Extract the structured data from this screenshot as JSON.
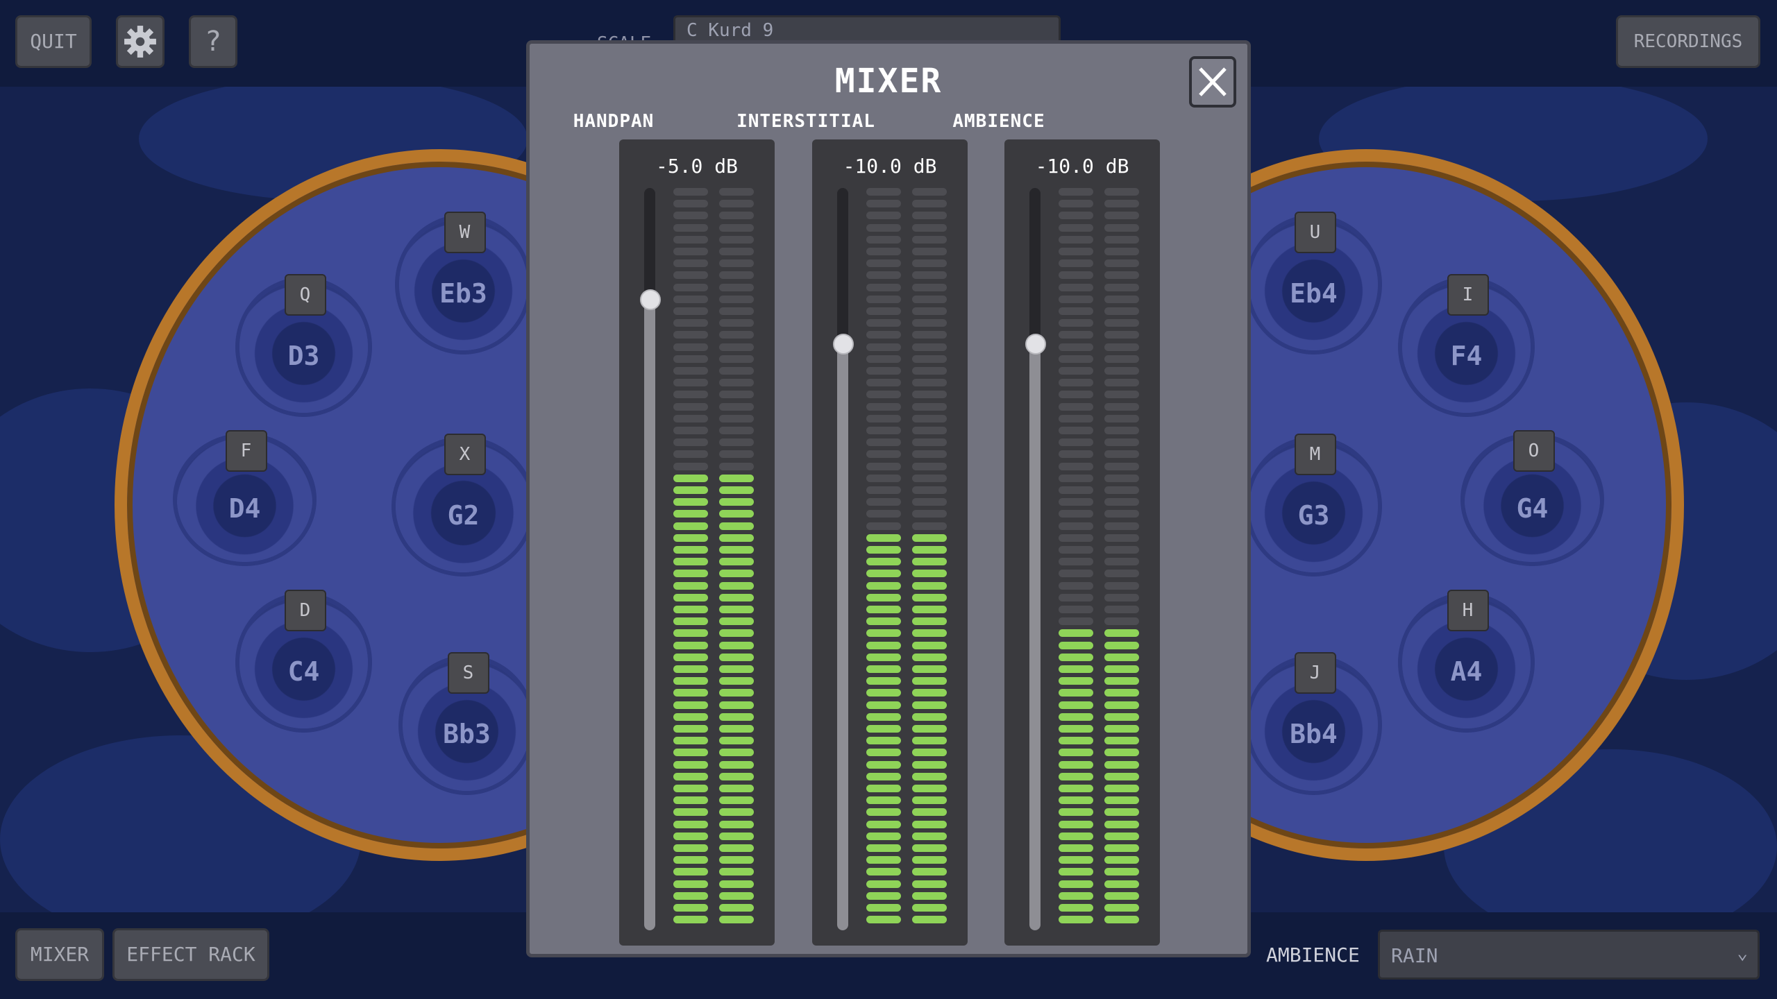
{
  "toolbar": {
    "quit_label": "QUIT",
    "help_label": "?",
    "scale_label": "SCALE",
    "scale_value": "C Kurd 9",
    "recordings_label": "RECORDINGS"
  },
  "bottom": {
    "mixer_label": "MIXER",
    "effect_rack_label": "EFFECT RACK",
    "ambience_label": "AMBIENCE",
    "ambience_value": "RAIN"
  },
  "handpan_left": [
    {
      "key": "W",
      "note": "Eb3"
    },
    {
      "key": "Q",
      "note": "D3"
    },
    {
      "key": "F",
      "note": "D4"
    },
    {
      "key": "X",
      "note": "G2"
    },
    {
      "key": "D",
      "note": "C4"
    },
    {
      "key": "S",
      "note": "Bb3"
    }
  ],
  "handpan_right": [
    {
      "key": "U",
      "note": "Eb4"
    },
    {
      "key": "I",
      "note": "F4"
    },
    {
      "key": "M",
      "note": "G3"
    },
    {
      "key": "O",
      "note": "G4"
    },
    {
      "key": "H",
      "note": "A4"
    },
    {
      "key": "J",
      "note": "Bb4"
    }
  ],
  "mixer": {
    "title": "MIXER",
    "channels": [
      {
        "name": "HANDPAN",
        "db_label": "-5.0 dB",
        "fader_level": 0.85,
        "meter_level": 0.62
      },
      {
        "name": "INTERSTITIAL",
        "db_label": "-10.0 dB",
        "fader_level": 0.79,
        "meter_level": 0.54
      },
      {
        "name": "AMBIENCE",
        "db_label": "-10.0 dB",
        "fader_level": 0.79,
        "meter_level": 0.4
      }
    ]
  },
  "colors": {
    "meter_on": "#8fd458",
    "meter_off": "#4d4d52",
    "dialog": "#72737f",
    "pan_rim": "#b8772a"
  }
}
